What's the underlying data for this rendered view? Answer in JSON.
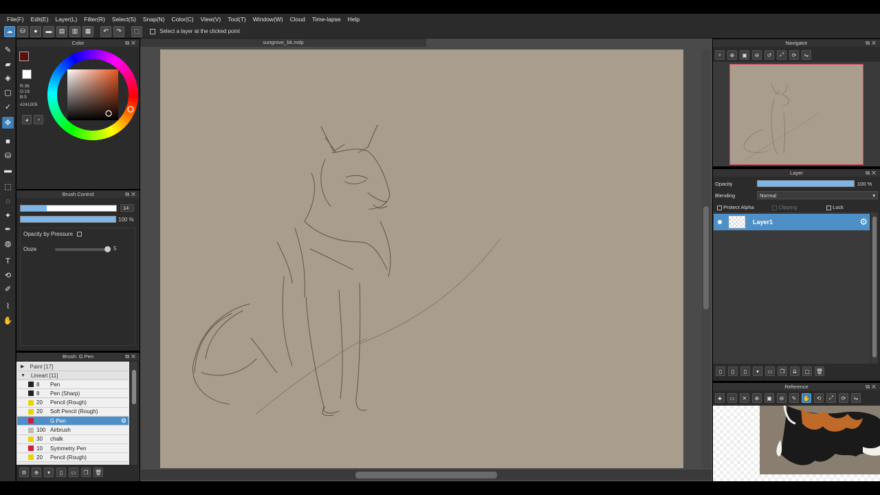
{
  "menu": [
    "File(F)",
    "Edit(E)",
    "Layer(L)",
    "Filter(R)",
    "Select(S)",
    "Snap(N)",
    "Color(C)",
    "View(V)",
    "Tool(T)",
    "Window(W)",
    "Cloud",
    "Time-lapse",
    "Help"
  ],
  "toolbar": {
    "select_layer_label": "Select a layer at the clicked point"
  },
  "canvas": {
    "tab_title": "sungrove_bk.mdp",
    "paper_color": "#a99d8d"
  },
  "color_panel": {
    "title": "Color",
    "r": "R:36",
    "g": "G:16",
    "b": "B:5",
    "hex": "#241005",
    "primary": "#5a1010",
    "secondary": "#ffffff"
  },
  "brush_control": {
    "title": "Brush Control",
    "size_value": "14",
    "opacity_value": "100",
    "opacity_unit": "%",
    "opacity_by_pressure_label": "Opacity by Pressure",
    "ooze_label": "Ooze",
    "ooze_value": "5",
    "size_fraction": 0.27,
    "ooze_fraction": 0.95
  },
  "brush_list": {
    "title": "Brush: G Pen",
    "categories": [
      {
        "label": "Paint [17]",
        "arrow": "▶"
      },
      {
        "label": "Lineart [11]",
        "arrow": "▼"
      }
    ],
    "brushes": [
      {
        "size": "8",
        "name": "Pen",
        "swatch": "#222222"
      },
      {
        "size": "8",
        "name": "Pen (Sharp)",
        "swatch": "#222222"
      },
      {
        "size": "20",
        "name": "Pencil (Rough)",
        "swatch": "#e8d400"
      },
      {
        "size": "20",
        "name": "Soft Pencil (Rough)",
        "swatch": "#e8d400"
      },
      {
        "size": "",
        "name": "G Pen",
        "swatch": "#d01c3a",
        "selected": true
      },
      {
        "size": "100",
        "name": "Airbrush",
        "swatch": "#bbbbbb"
      },
      {
        "size": "30",
        "name": "chalk",
        "swatch": "#e8d400"
      },
      {
        "size": "10",
        "name": "Symmetry Pen",
        "swatch": "#d01c3a"
      },
      {
        "size": "20",
        "name": "Pencil (Rough)",
        "swatch": "#e8d400"
      }
    ]
  },
  "navigator": {
    "title": "Navigator"
  },
  "layer_panel": {
    "title": "Layer",
    "opacity_label": "Opacity",
    "opacity_value": "100 %",
    "blending_label": "Blending",
    "blending_value": "Normal",
    "protect_alpha_label": "Protect Alpha",
    "clipping_label": "Clipping",
    "lock_label": "Lock",
    "layer_name": "Layer1"
  },
  "reference": {
    "title": "Reference"
  },
  "colors": {
    "accent": "#4f8fc8",
    "panel_bg": "#2b2b2b"
  }
}
